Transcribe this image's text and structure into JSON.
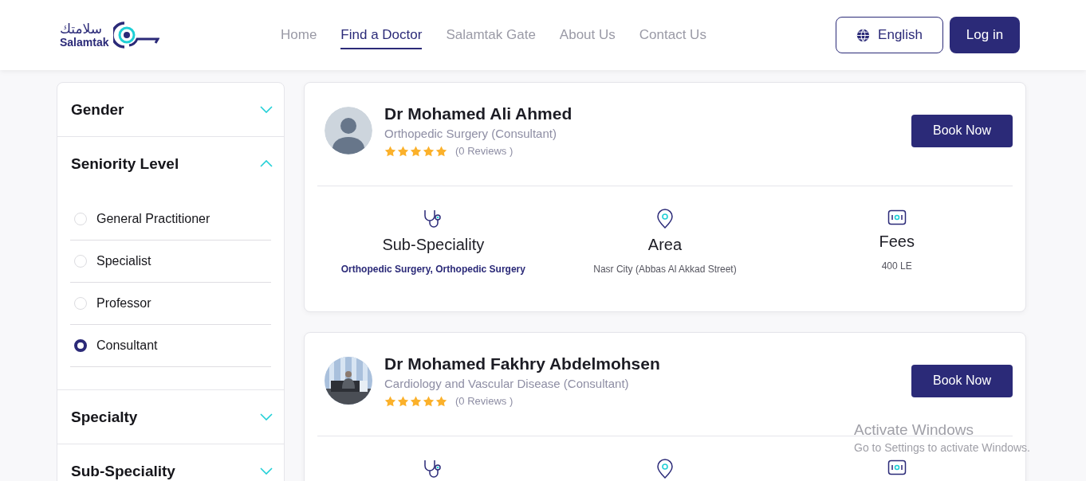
{
  "logo": {
    "arabic": "سلامتك",
    "latin": "Salamtak"
  },
  "nav": [
    {
      "label": "Home",
      "selected": false
    },
    {
      "label": "Find a Doctor",
      "selected": true
    },
    {
      "label": "Salamtak Gate",
      "selected": false
    },
    {
      "label": "About Us",
      "selected": false
    },
    {
      "label": "Contact Us",
      "selected": false
    }
  ],
  "language_button": "English",
  "login_button": "Log in",
  "filters": [
    {
      "title": "Gender",
      "expanded": false
    },
    {
      "title": "Seniority Level",
      "expanded": true,
      "options": [
        {
          "label": "General Practitioner",
          "selected": false
        },
        {
          "label": "Specialist",
          "selected": false
        },
        {
          "label": "Professor",
          "selected": false
        },
        {
          "label": "Consultant",
          "selected": true
        }
      ]
    },
    {
      "title": "Specialty",
      "expanded": false
    },
    {
      "title": "Sub-Speciality",
      "expanded": false
    }
  ],
  "doctors": [
    {
      "name": "Dr Mohamed Ali Ahmed",
      "title": "Orthopedic Surgery (Consultant)",
      "has_photo": false,
      "stars": 5,
      "reviews": "(0 Reviews )",
      "book_button": "Book Now",
      "info": [
        {
          "kind": "subspeciality",
          "label": "Sub-Speciality",
          "value": "Orthopedic Surgery, Orthopedic Surgery"
        },
        {
          "kind": "area",
          "label": "Area",
          "value": "Nasr City (Abbas Al Akkad Street)"
        },
        {
          "kind": "fees",
          "label": "Fees",
          "value": "400 LE"
        }
      ]
    },
    {
      "name": "Dr Mohamed Fakhry Abdelmohsen",
      "title": "Cardiology and Vascular Disease (Consultant)",
      "has_photo": true,
      "stars": 5,
      "reviews": "(0 Reviews )",
      "book_button": "Book Now",
      "info": [
        {
          "kind": "subspeciality"
        },
        {
          "kind": "area"
        },
        {
          "kind": "fees"
        }
      ]
    }
  ],
  "os_overlay": {
    "title": "Activate Windows",
    "subtitle": "Go to Settings to activate Windows."
  }
}
